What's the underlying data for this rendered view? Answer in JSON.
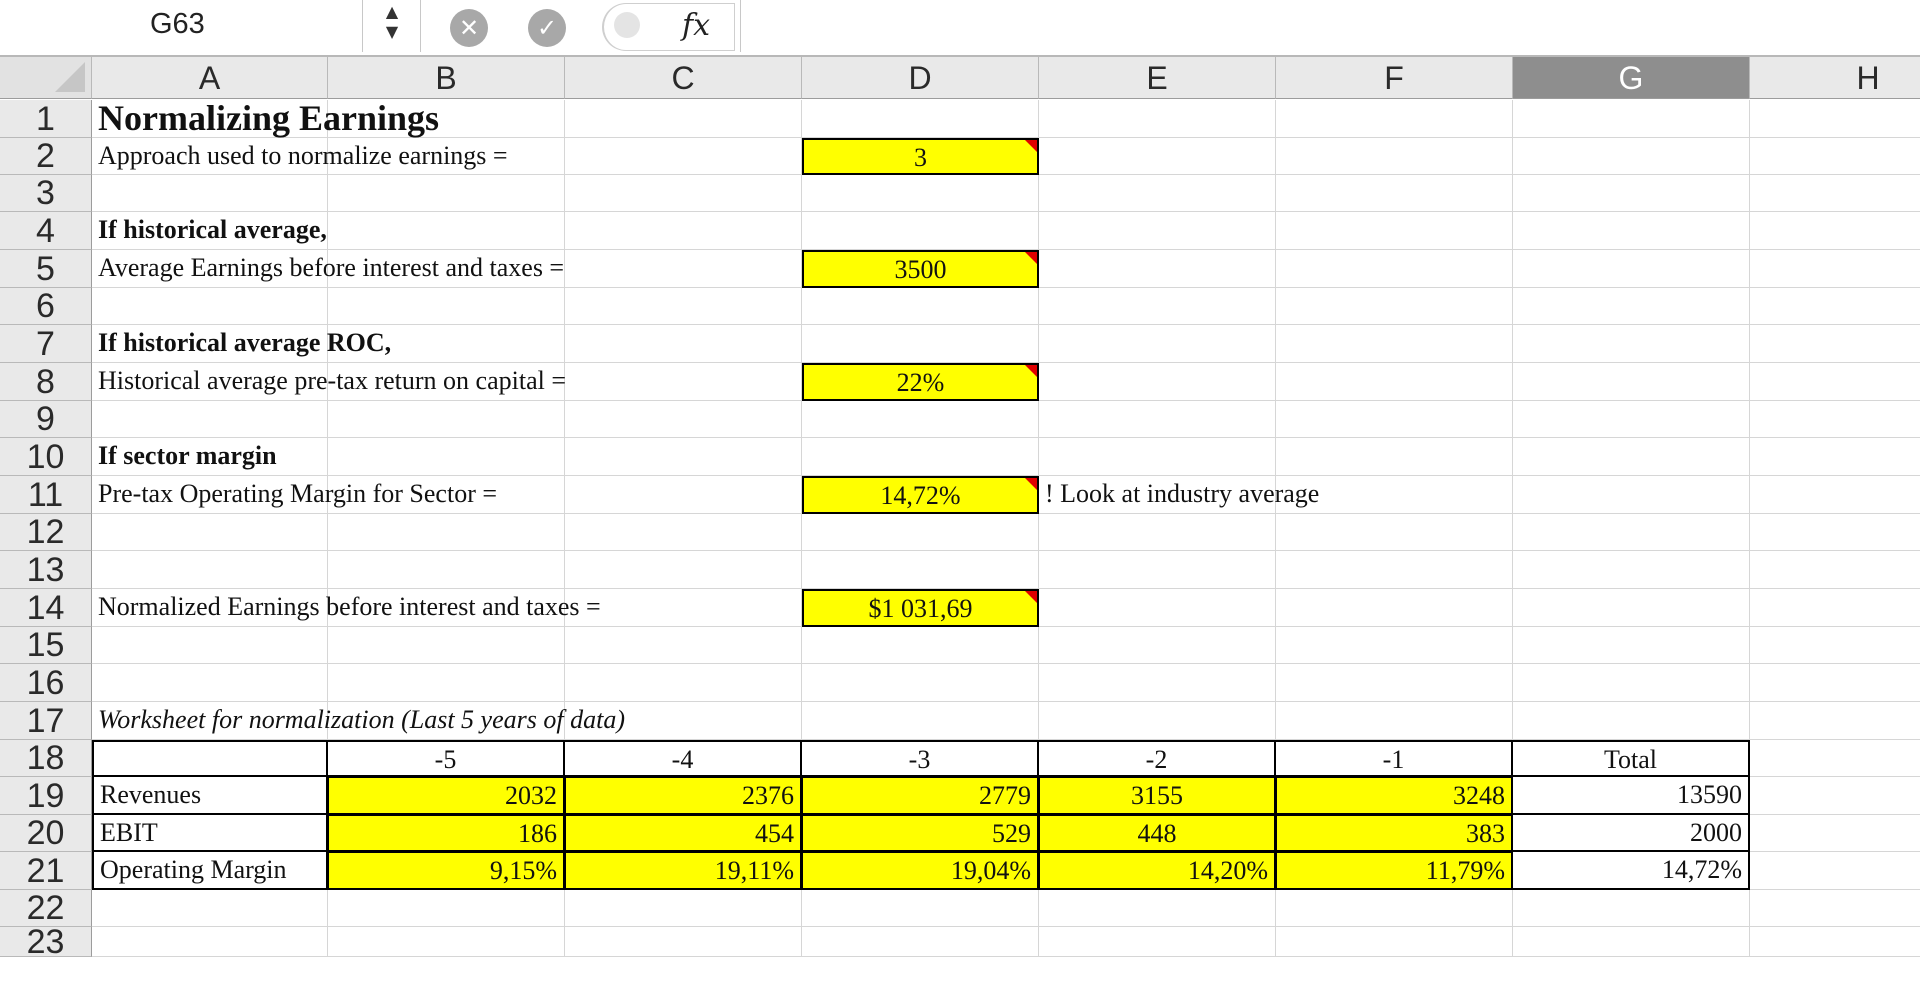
{
  "formula_bar": {
    "cell_ref": "G63",
    "stepper_up": "▲",
    "stepper_down": "▼",
    "cancel_glyph": "✕",
    "confirm_glyph": "✓",
    "fx_label": "fx",
    "formula": ""
  },
  "columns": [
    "A",
    "B",
    "C",
    "D",
    "E",
    "F",
    "G",
    "H"
  ],
  "selected_column": "G",
  "rows": [
    "1",
    "2",
    "3",
    "4",
    "5",
    "6",
    "7",
    "8",
    "9",
    "10",
    "11",
    "12",
    "13",
    "14",
    "15",
    "16",
    "17",
    "18",
    "19",
    "20",
    "21",
    "22",
    "23"
  ],
  "sheet": {
    "title": "Normalizing Earnings",
    "approach_label": "Approach used to normalize earnings =",
    "approach_value": "3",
    "hist_avg_heading": "If historical average,",
    "avg_ebit_label": "Average Earnings before interest and taxes =",
    "avg_ebit_value": "3500",
    "hist_roc_heading": "If historical average ROC,",
    "roc_label": "Historical average pre-tax return on capital =",
    "roc_value": "22%",
    "sector_heading": "If sector margin",
    "sector_label": "Pre-tax Operating Margin for Sector =",
    "sector_value": "14,72%",
    "sector_note": "! Look at industry average",
    "normalized_label": "Normalized Earnings before interest and taxes =",
    "normalized_value": "$1 031,69",
    "worksheet_heading": "Worksheet for normalization (Last 5 years of data)"
  },
  "table": {
    "years": [
      "-5",
      "-4",
      "-3",
      "-2",
      "-1"
    ],
    "total_label": "Total",
    "rows": [
      {
        "label": "Revenues",
        "values": [
          "2032",
          "2376",
          "2779",
          "3155",
          "3248"
        ],
        "total": "13590"
      },
      {
        "label": "EBIT",
        "values": [
          "186",
          "454",
          "529",
          "448",
          "383"
        ],
        "total": "2000"
      },
      {
        "label": "Operating Margin",
        "values": [
          "9,15%",
          "19,11%",
          "19,04%",
          "14,20%",
          "11,79%"
        ],
        "total": "14,72%"
      }
    ]
  },
  "colors": {
    "input_fill": "#ffff00",
    "comment_marker": "#e00000",
    "header_bg": "#e9e9e9",
    "selected_header_bg": "#8e8e8e"
  }
}
